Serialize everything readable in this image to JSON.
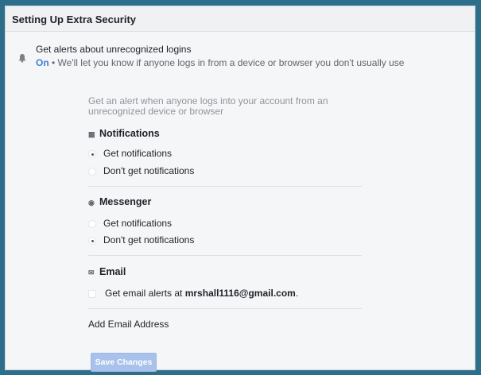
{
  "header": {
    "title": "Setting Up Extra Security"
  },
  "alerts": {
    "title": "Get alerts about unrecognized logins",
    "status": "On",
    "status_text": " • We'll let you know if anyone logs in from a device or browser you don't usually use",
    "bell_icon": "bell-icon"
  },
  "description_line1": "Get an alert when anyone logs into your account from an",
  "description_line2": "unrecognized device or browser",
  "notifications": {
    "heading": "Notifications",
    "icon": "notifications-icon",
    "options": [
      {
        "label": "Get notifications",
        "selected": true
      },
      {
        "label": "Don't get notifications",
        "selected": false
      }
    ]
  },
  "messenger": {
    "heading": "Messenger",
    "icon": "messenger-icon",
    "options": [
      {
        "label": "Get notifications",
        "selected": false
      },
      {
        "label": "Don't get notifications",
        "selected": true
      }
    ]
  },
  "email": {
    "heading": "Email",
    "icon": "email-icon",
    "option_prefix": "Get email alerts at ",
    "address": "mrshall1116@gmail.com",
    "suffix": ".",
    "checked": false
  },
  "add_email_label": "Add Email Address",
  "save_label": "Save Changes",
  "colors": {
    "accent": "#4080d6",
    "button": "#a9c2eb",
    "frame_bg": "#2d6f8a"
  }
}
